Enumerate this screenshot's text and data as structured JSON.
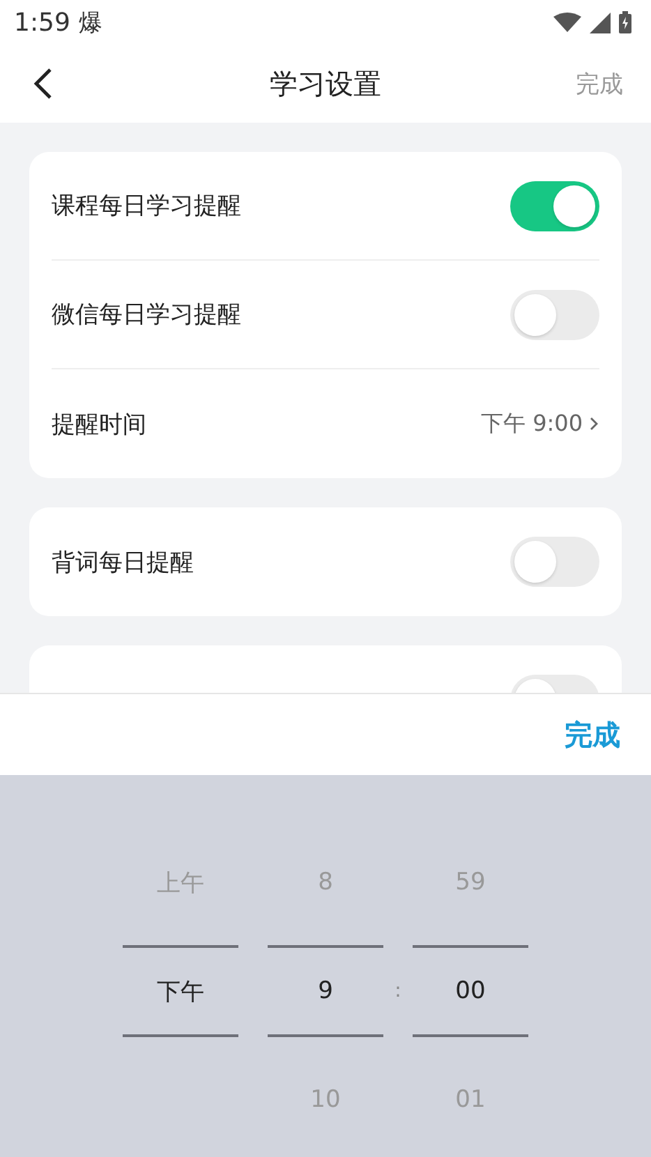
{
  "status_bar": {
    "time": "1:59",
    "notification": "爆"
  },
  "header": {
    "title": "学习设置",
    "done": "完成"
  },
  "groups": [
    {
      "rows": [
        {
          "kind": "toggle",
          "label": "课程每日学习提醒",
          "on": true
        },
        {
          "kind": "toggle",
          "label": "微信每日学习提醒",
          "on": false
        },
        {
          "kind": "value",
          "label": "提醒时间",
          "value": "下午 9:00"
        }
      ]
    },
    {
      "rows": [
        {
          "kind": "toggle",
          "label": "背词每日提醒",
          "on": false
        }
      ]
    },
    {
      "rows": [
        {
          "kind": "toggle",
          "on": false
        }
      ]
    }
  ],
  "picker": {
    "done": "完成",
    "separator": ":",
    "columns": [
      {
        "items": [
          {
            "text": "上午",
            "selected": false
          },
          {
            "text": "下午",
            "selected": true
          }
        ]
      },
      {
        "items": [
          {
            "text": "8",
            "selected": false
          },
          {
            "text": "9",
            "selected": true
          },
          {
            "text": "10",
            "selected": false
          }
        ]
      },
      {
        "items": [
          {
            "text": "59",
            "selected": false
          },
          {
            "text": "00",
            "selected": true
          },
          {
            "text": "01",
            "selected": false
          }
        ]
      }
    ]
  }
}
